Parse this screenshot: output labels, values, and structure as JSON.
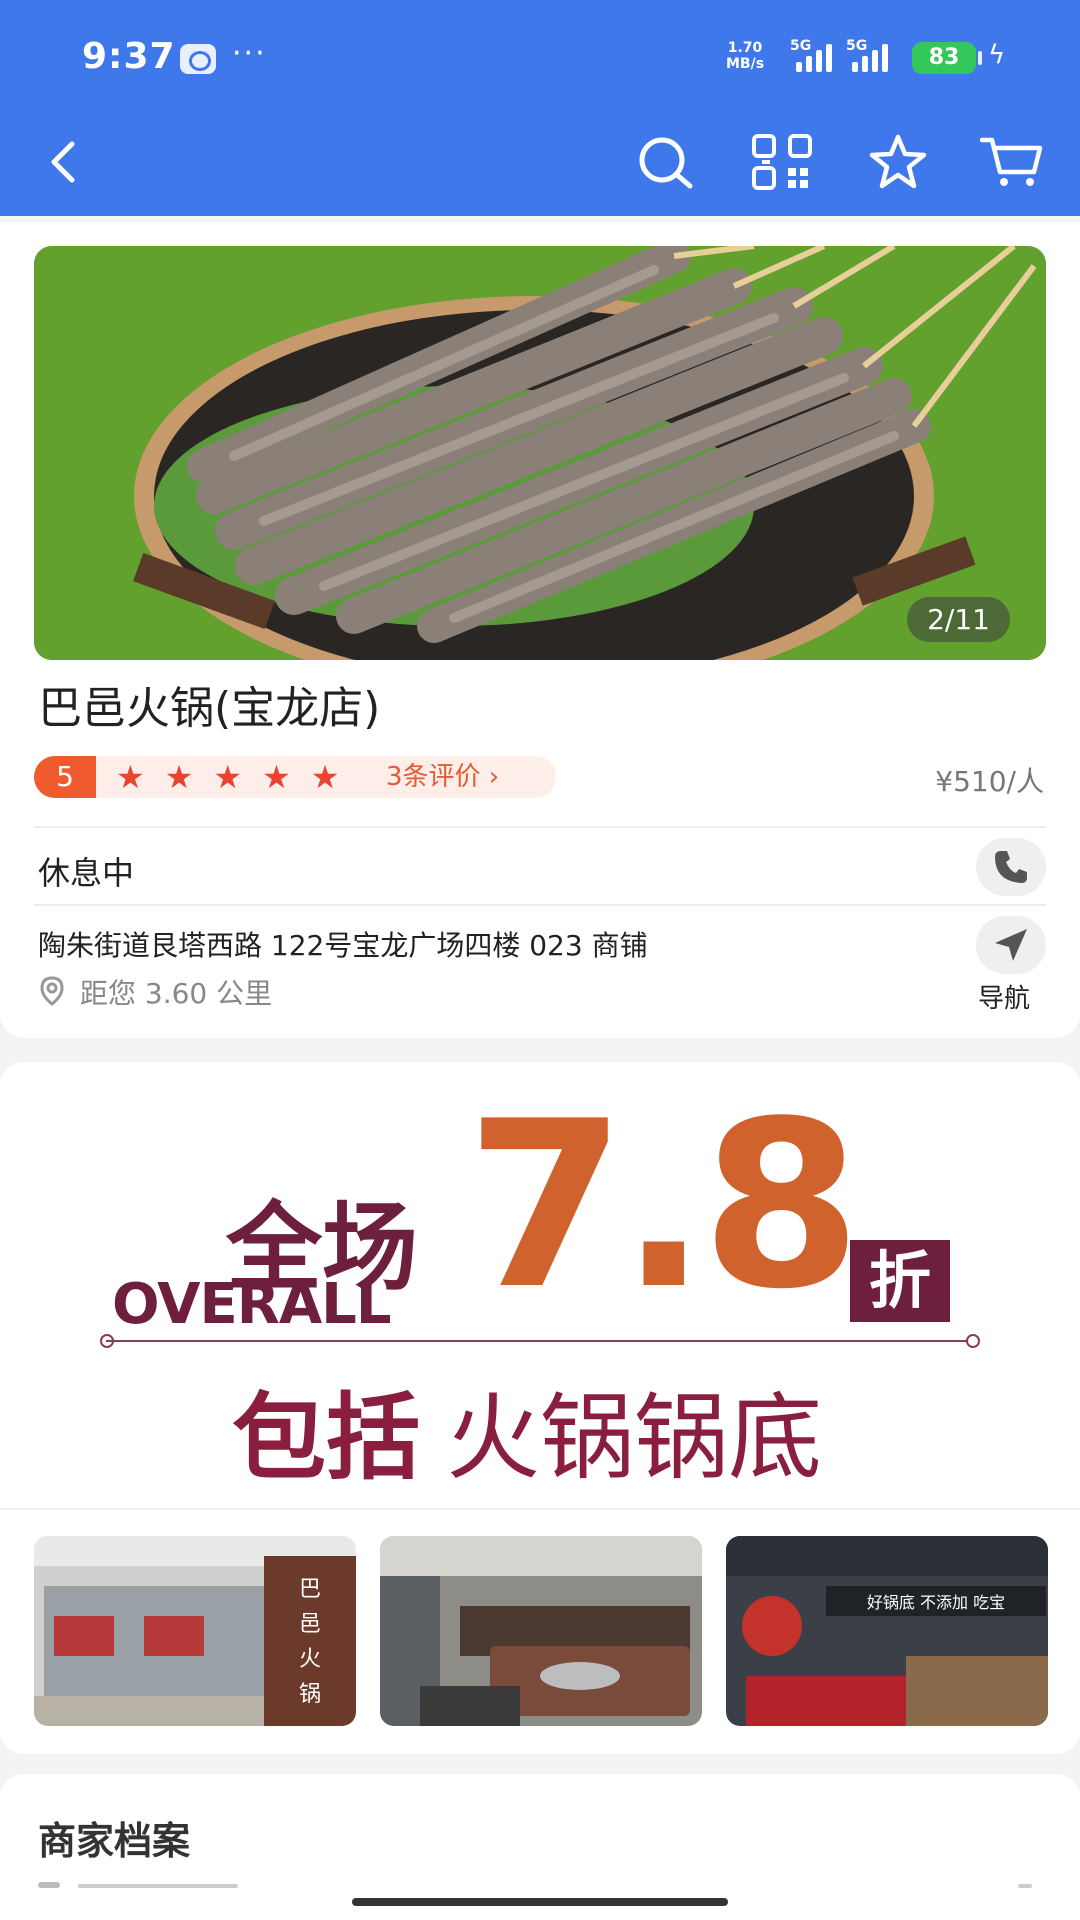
{
  "status_bar": {
    "time": "9:37",
    "more": "···",
    "speed_value": "1.70",
    "speed_unit": "MB/s",
    "signal1_label": "5G",
    "signal2_label": "5G",
    "battery": "83"
  },
  "nav": {
    "icons": [
      "back-icon",
      "search-icon",
      "qr-code-icon",
      "star-icon",
      "cart-icon"
    ]
  },
  "shop": {
    "photo_counter": "2/11",
    "name": "巴邑火锅(宝龙店)",
    "rating": "5",
    "stars": "★★★★★",
    "stars_count": 5,
    "review_link": "3条评价 ›",
    "price": "¥510/人",
    "open_status": "休息中",
    "address": "陶朱街道艮塔西路 122号宝龙广场四楼 023 商铺",
    "distance": "距您 3.60 公里",
    "nav_label": "导航"
  },
  "promo": {
    "label_cn": "全场",
    "label_en": "OVERALL",
    "discount": "7.8",
    "unit": "折",
    "subtitle_bold": "包括",
    "subtitle_rest": "火锅锅底"
  },
  "gallery": {
    "thumbs": [
      "storefront-photo",
      "dining-area-photo",
      "entrance-photo"
    ]
  },
  "profile": {
    "title": "商家档案"
  },
  "colors": {
    "header_blue": "#3f78ea",
    "rating_orange": "#ef5a2f",
    "star_red": "#e8442f",
    "promo_purple": "#6e1f3d",
    "promo_orange": "#d0622e"
  }
}
